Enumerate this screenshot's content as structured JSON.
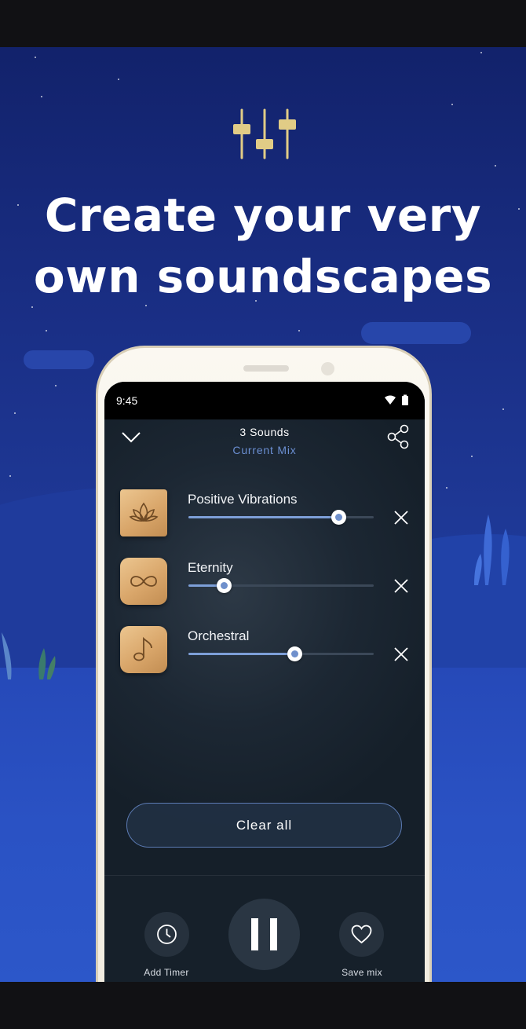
{
  "headline": {
    "line1": "Create your very",
    "line2": "own soundscapes"
  },
  "phone": {
    "status_bar": {
      "time": "9:45"
    },
    "header": {
      "title": "3 Sounds",
      "subtitle": "Current Mix"
    },
    "sounds": [
      {
        "name": "Positive Vibrations",
        "volume": 0.81,
        "icon": "lotus-icon"
      },
      {
        "name": "Eternity",
        "volume": 0.19,
        "icon": "infinity-icon"
      },
      {
        "name": "Orchestral",
        "volume": 0.57,
        "icon": "music-note-icon"
      }
    ],
    "clear_all_label": "Clear all",
    "controls": {
      "timer_label": "Add Timer",
      "save_label": "Save mix"
    }
  },
  "colors": {
    "accent_blue": "#6b8fd2",
    "tile_wood": "#d9a66a",
    "icon_gold": "#e1cc86"
  }
}
